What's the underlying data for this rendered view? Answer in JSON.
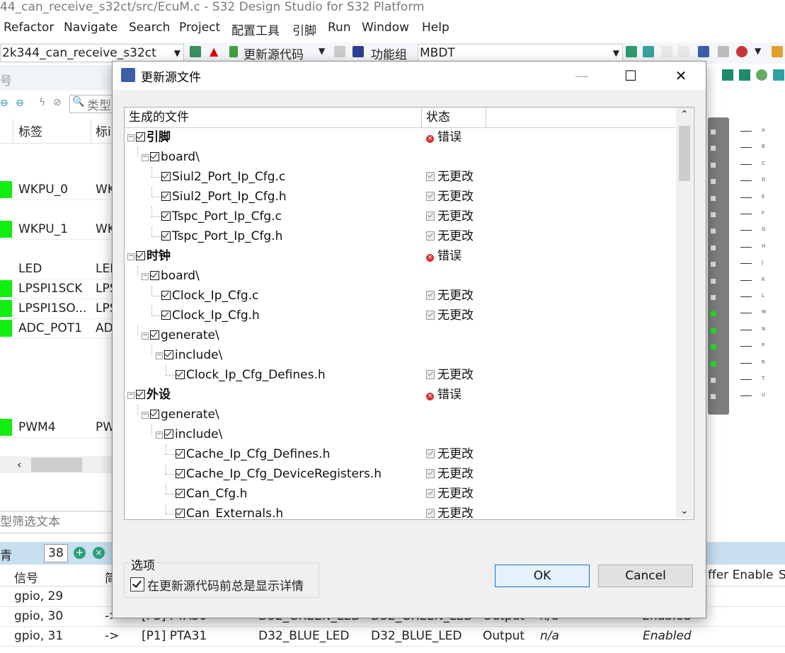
{
  "ide": {
    "window_title": "44_can_receive_s32ct/src/EcuM.c - S32 Design Studio for S32 Platform",
    "menu": [
      "Refactor",
      "Navigate",
      "Search",
      "Project",
      "配置工具",
      "引脚",
      "Run",
      "Window",
      "Help"
    ],
    "toolbar": {
      "project_combo": "2k344_can_receive_s32ct",
      "update_source_label": "更新源代码",
      "function_group_label": "功能组",
      "function_group_value": "MBDT"
    },
    "left_panel": {
      "tab_fragment": "号",
      "type_filter_fragment": "类型",
      "col_label": "标签",
      "col_label2": "标i",
      "signals": [
        {
          "label": "WKPU_0",
          "label2": "WK",
          "active": true
        },
        {
          "label": "WKPU_1",
          "label2": "WK",
          "active": true
        },
        {
          "label": "LED",
          "label2": "LEI",
          "active": false
        },
        {
          "label": "LPSPI1SCK",
          "label2": "LPS",
          "active": true
        },
        {
          "label": "LPSPI1SO...",
          "label2": "LPS",
          "active": true
        },
        {
          "label": "ADC_POT1",
          "label2": "AD",
          "active": true
        },
        {
          "label": "PWM4",
          "label2": "PW",
          "active": true
        }
      ],
      "filter_text": "型筛选文本"
    },
    "bottom_table": {
      "left_header_fragment": "青",
      "count": "38",
      "col_signal": "信号",
      "col_fragment": "简",
      "col_buffer": "ffer Enable",
      "col_last": "S",
      "rows": [
        {
          "signal": "gpio, 29",
          "arrow": "",
          "pin": "",
          "label": "",
          "label2": "",
          "dir": "",
          "na": "",
          "enabled": ""
        },
        {
          "signal": "gpio, 30",
          "arrow": "->",
          "pin": "[P3] PTA30",
          "label": "D32_GREEN_LED",
          "label2": "D32_GREEN_LED",
          "dir": "Output",
          "na": "n/a",
          "enabled": "Enabled"
        },
        {
          "signal": "gpio, 31",
          "arrow": "->",
          "pin": "[P1] PTA31",
          "label": "D32_BLUE_LED",
          "label2": "D32_BLUE_LED",
          "dir": "Output",
          "na": "n/a",
          "enabled": "Enabled"
        }
      ]
    },
    "chip_pin_labels": [
      "A",
      "B",
      "C",
      "D",
      "E",
      "F",
      "G",
      "H",
      "J",
      "K",
      "L",
      "M",
      "N",
      "P",
      "R",
      "T",
      "U"
    ]
  },
  "dialog": {
    "title": "更新源文件",
    "columns": {
      "file": "生成的文件",
      "status": "状态"
    },
    "rows": [
      {
        "name": "引脚",
        "level": 0,
        "bold": true,
        "status": "错误",
        "status_kind": "error"
      },
      {
        "name": "board\\",
        "level": 1,
        "bold": false,
        "status": "",
        "status_kind": "none"
      },
      {
        "name": "Siul2_Port_Ip_Cfg.c",
        "level": 2,
        "bold": false,
        "status": "无更改",
        "status_kind": "unchanged"
      },
      {
        "name": "Siul2_Port_Ip_Cfg.h",
        "level": 2,
        "bold": false,
        "status": "无更改",
        "status_kind": "unchanged"
      },
      {
        "name": "Tspc_Port_Ip_Cfg.c",
        "level": 2,
        "bold": false,
        "status": "无更改",
        "status_kind": "unchanged"
      },
      {
        "name": "Tspc_Port_Ip_Cfg.h",
        "level": 2,
        "bold": false,
        "status": "无更改",
        "status_kind": "unchanged"
      },
      {
        "name": "时钟",
        "level": 0,
        "bold": true,
        "status": "错误",
        "status_kind": "error"
      },
      {
        "name": "board\\",
        "level": 1,
        "bold": false,
        "status": "",
        "status_kind": "none"
      },
      {
        "name": "Clock_Ip_Cfg.c",
        "level": 2,
        "bold": false,
        "status": "无更改",
        "status_kind": "unchanged"
      },
      {
        "name": "Clock_Ip_Cfg.h",
        "level": 2,
        "bold": false,
        "status": "无更改",
        "status_kind": "unchanged"
      },
      {
        "name": "generate\\",
        "level": 1,
        "bold": false,
        "status": "",
        "status_kind": "none"
      },
      {
        "name": "include\\",
        "level": 2,
        "bold": false,
        "status": "",
        "status_kind": "none"
      },
      {
        "name": "Clock_Ip_Cfg_Defines.h",
        "level": 3,
        "bold": false,
        "status": "无更改",
        "status_kind": "unchanged"
      },
      {
        "name": "外设",
        "level": 0,
        "bold": true,
        "status": "错误",
        "status_kind": "error"
      },
      {
        "name": "generate\\",
        "level": 1,
        "bold": false,
        "status": "",
        "status_kind": "none"
      },
      {
        "name": "include\\",
        "level": 2,
        "bold": false,
        "status": "",
        "status_kind": "none"
      },
      {
        "name": "Cache_Ip_Cfg_Defines.h",
        "level": 3,
        "bold": false,
        "status": "无更改",
        "status_kind": "unchanged"
      },
      {
        "name": "Cache_Ip_Cfg_DeviceRegisters.h",
        "level": 3,
        "bold": false,
        "status": "无更改",
        "status_kind": "unchanged"
      },
      {
        "name": "Can_Cfg.h",
        "level": 3,
        "bold": false,
        "status": "无更改",
        "status_kind": "unchanged"
      },
      {
        "name": "Can_Externals.h",
        "level": 3,
        "bold": false,
        "status": "无更改",
        "status_kind": "unchanged"
      }
    ],
    "options_title": "选项",
    "option_label": "在更新源代码前总是显示详情",
    "option_checked": true,
    "ok_label": "OK",
    "cancel_label": "Cancel"
  },
  "colors": {
    "active_signal": "#11ee11",
    "error": "#d93030",
    "ok_border": "#0078d7"
  }
}
